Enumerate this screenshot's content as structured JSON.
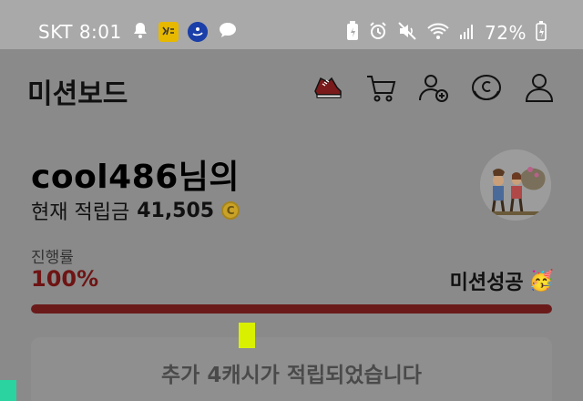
{
  "status_bar": {
    "carrier_time": "SKT 8:01",
    "battery": "72%",
    "icons_left": [
      "bell-icon",
      "kb-app-icon",
      "super-sol-icon",
      "chat-icon"
    ],
    "icons_right": [
      "battery-saver-icon",
      "alarm-icon",
      "mute-icon",
      "wifi-icon",
      "signal-icon",
      "battery-icon"
    ]
  },
  "app_bar": {
    "title": "미션보드",
    "icons": [
      "sneaker-icon",
      "cart-icon",
      "add-friend-icon",
      "cash-icon",
      "profile-icon"
    ]
  },
  "user": {
    "greeting": "cool486님의",
    "balance_label": "현재 적립금",
    "balance_value": "41,505",
    "coin_symbol": "C"
  },
  "progress": {
    "label": "진행률",
    "percent_text": "100%",
    "value": 1.0,
    "status": "미션성공",
    "status_emoji": "🥳"
  },
  "notice": {
    "text": "추가 4캐시가 적립되었습니다"
  },
  "colors": {
    "accent": "#6b1a1a",
    "dim_overlay": "#8a8a8a"
  }
}
